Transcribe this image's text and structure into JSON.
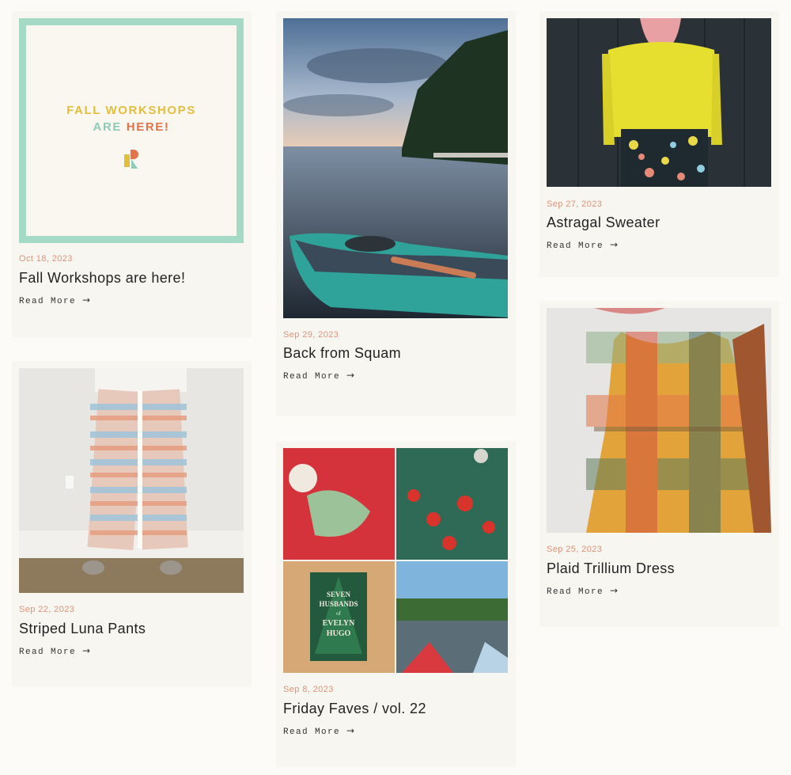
{
  "read_more_label": "Read More",
  "arrow_glyph": "→",
  "workshop_graphic": {
    "line1": "FALL WORKSHOPS",
    "are": "ARE",
    "here": "HERE!"
  },
  "posts": [
    {
      "date": "Oct 18, 2023",
      "title": "Fall Workshops are here!"
    },
    {
      "date": "Sep 22, 2023",
      "title": "Striped Luna Pants"
    },
    {
      "date": "Sep 29, 2023",
      "title": "Back from Squam"
    },
    {
      "date": "Sep 8, 2023",
      "title": "Friday Faves / vol. 22"
    },
    {
      "date": "Sep 27, 2023",
      "title": "Astragal Sweater"
    },
    {
      "date": "Sep 25, 2023",
      "title": "Plaid Trillium Dress"
    }
  ],
  "book_cover": {
    "line1": "SEVEN",
    "line2": "HUSBANDS",
    "line3": "of",
    "line4": "EVELYN",
    "line5": "HUGO"
  },
  "colors": {
    "date": "#e0937a",
    "frame": "#a5dac6",
    "card_bg": "#f8f6f0",
    "page_bg": "#fcfbf7"
  }
}
